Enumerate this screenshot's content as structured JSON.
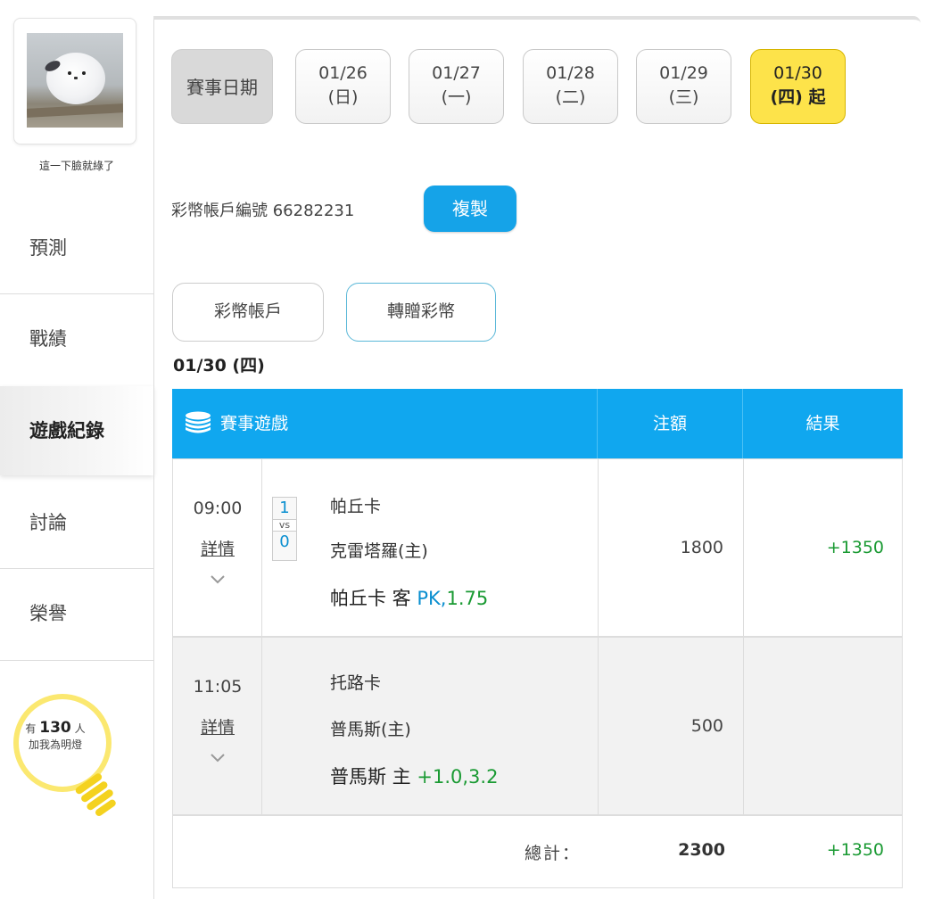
{
  "sidebar": {
    "username": "這一下臉就綠了",
    "nav": [
      {
        "label": "預測"
      },
      {
        "label": "戰績"
      },
      {
        "label": "遊戲紀錄"
      },
      {
        "label": "討論"
      },
      {
        "label": "榮譽"
      }
    ],
    "fans": {
      "prefix": "有",
      "count": "130",
      "suffix": "人",
      "caption": "加我為明燈"
    }
  },
  "date_bar": {
    "label": "賽事日期",
    "dates": [
      {
        "date": "01/26",
        "day": "(日)"
      },
      {
        "date": "01/27",
        "day": "(一)"
      },
      {
        "date": "01/28",
        "day": "(二)"
      },
      {
        "date": "01/29",
        "day": "(三)"
      },
      {
        "date": "01/30",
        "day": "(四) 起"
      }
    ]
  },
  "account": {
    "text": "彩幣帳戶編號 66282231",
    "copy_label": "複製"
  },
  "tabs": [
    {
      "label": "彩幣帳戶"
    },
    {
      "label": "轉贈彩幣"
    }
  ],
  "selected_date": "01/30 (四)",
  "table": {
    "headers": {
      "game": "賽事遊戲",
      "amount": "注額",
      "result": "結果"
    },
    "rows": [
      {
        "time": "09:00",
        "detail": "詳情",
        "score_away": "1",
        "vs": "vs",
        "score_home": "0",
        "away": "帕丘卡",
        "home": "克雷塔羅(主)",
        "pick_team": "帕丘卡 客",
        "pick_odds": "PK,",
        "pick_price": "1.75",
        "amount": "1800",
        "result": "+1350"
      },
      {
        "time": "11:05",
        "detail": "詳情",
        "away": "托路卡",
        "home": "普馬斯(主)",
        "pick_team": "普馬斯 主",
        "pick_odds": "+1.0,",
        "pick_price": "3.2",
        "amount": "500",
        "result": ""
      }
    ],
    "total": {
      "label": "總計：",
      "amount": "2300",
      "result": "+1350"
    }
  },
  "colors": {
    "accent_blue": "#10a7ef",
    "highlight_yellow": "#fde34a",
    "win_green": "#1a9a33",
    "odds_blue": "#0a8fd0"
  }
}
